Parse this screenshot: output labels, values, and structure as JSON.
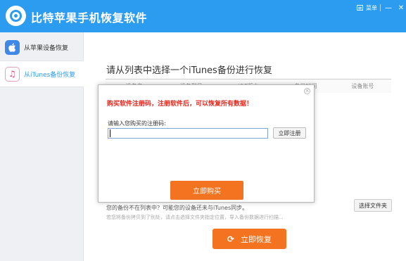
{
  "app": {
    "title": "比特苹果手机恢复软件"
  },
  "window": {
    "menu_label": "菜单",
    "minimize": "—",
    "close": "✕"
  },
  "sidebar": {
    "items": [
      {
        "label": "从苹果设备恢复",
        "icon": "apple-icon",
        "active": false
      },
      {
        "label": "从iTunes备份恢复",
        "icon": "music-note-icon",
        "active": true
      }
    ]
  },
  "main": {
    "title": "请从列表中选择一个iTunes备份进行恢复",
    "columns": [
      "设备名",
      "设备型号",
      "iOS版本",
      "备份时间",
      "设备账号"
    ],
    "select_folder_label": "选择文件夹",
    "hint_primary": "您的备份不在列表中？可能您的设备还未与iTunes同步。",
    "hint_secondary": "若您将备份拷贝到了别处，请点击选择文件夹指定位置，导入备份数据进行扫描...",
    "recover_label": "立即恢复"
  },
  "modal": {
    "close_symbol": "×",
    "warning": "购买软件注册码，注册软件后，可以恢复所有数据！",
    "input_label": "请输入您购买的注册码:",
    "input_value": "",
    "register_label": "立即注册",
    "buy_label": "立即购买"
  },
  "colors": {
    "header_blue": "#2b9cf0",
    "accent_orange": "#f47320",
    "warning_red": "#e8251b"
  }
}
